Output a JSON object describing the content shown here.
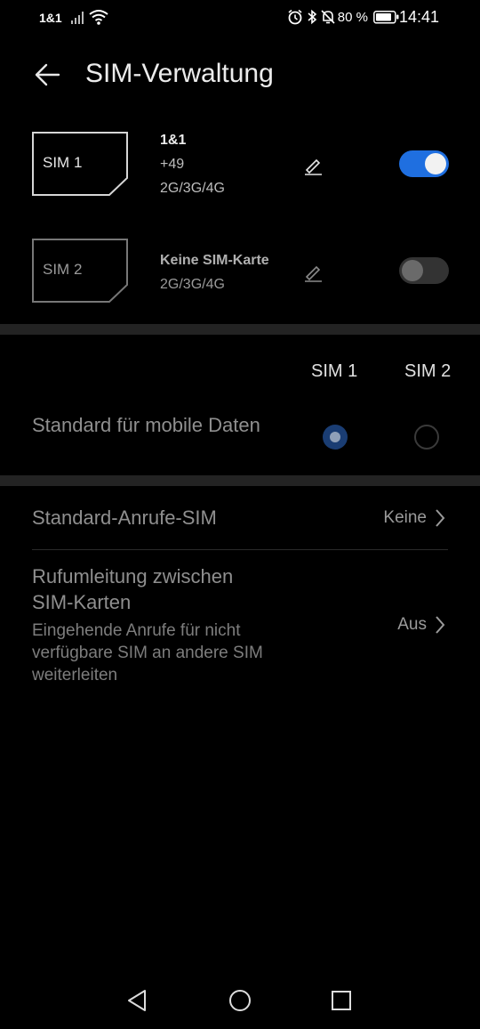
{
  "status_bar": {
    "carrier": "1&1",
    "battery": "80 %",
    "time": "14:41",
    "icons": [
      "signal-icon",
      "wifi-icon",
      "alarm-icon",
      "bluetooth-icon",
      "mute-icon",
      "battery-icon"
    ]
  },
  "header": {
    "title": "SIM-Verwaltung"
  },
  "sims": [
    {
      "card_label": "SIM 1",
      "name": "1&1",
      "number": "+49",
      "networks": "2G/3G/4G",
      "enabled": true
    },
    {
      "card_label": "SIM 2",
      "name": "Keine SIM-Karte",
      "networks": "2G/3G/4G",
      "enabled": false
    }
  ],
  "columns": {
    "sim1": "SIM 1",
    "sim2": "SIM 2"
  },
  "mobile_data": {
    "label": "Standard für mobile Daten",
    "selected": "SIM 1"
  },
  "calls": {
    "label": "Standard-Anrufe-SIM",
    "value": "Keine"
  },
  "forwarding": {
    "label": "Rufumleitung zwischen SIM-Karten",
    "description": "Eingehende Anrufe für nicht verfügbare SIM an andere SIM weiterleiten",
    "value": "Aus"
  },
  "colors": {
    "accent": "#1f6fe0",
    "background": "#000000",
    "band": "#232323"
  }
}
